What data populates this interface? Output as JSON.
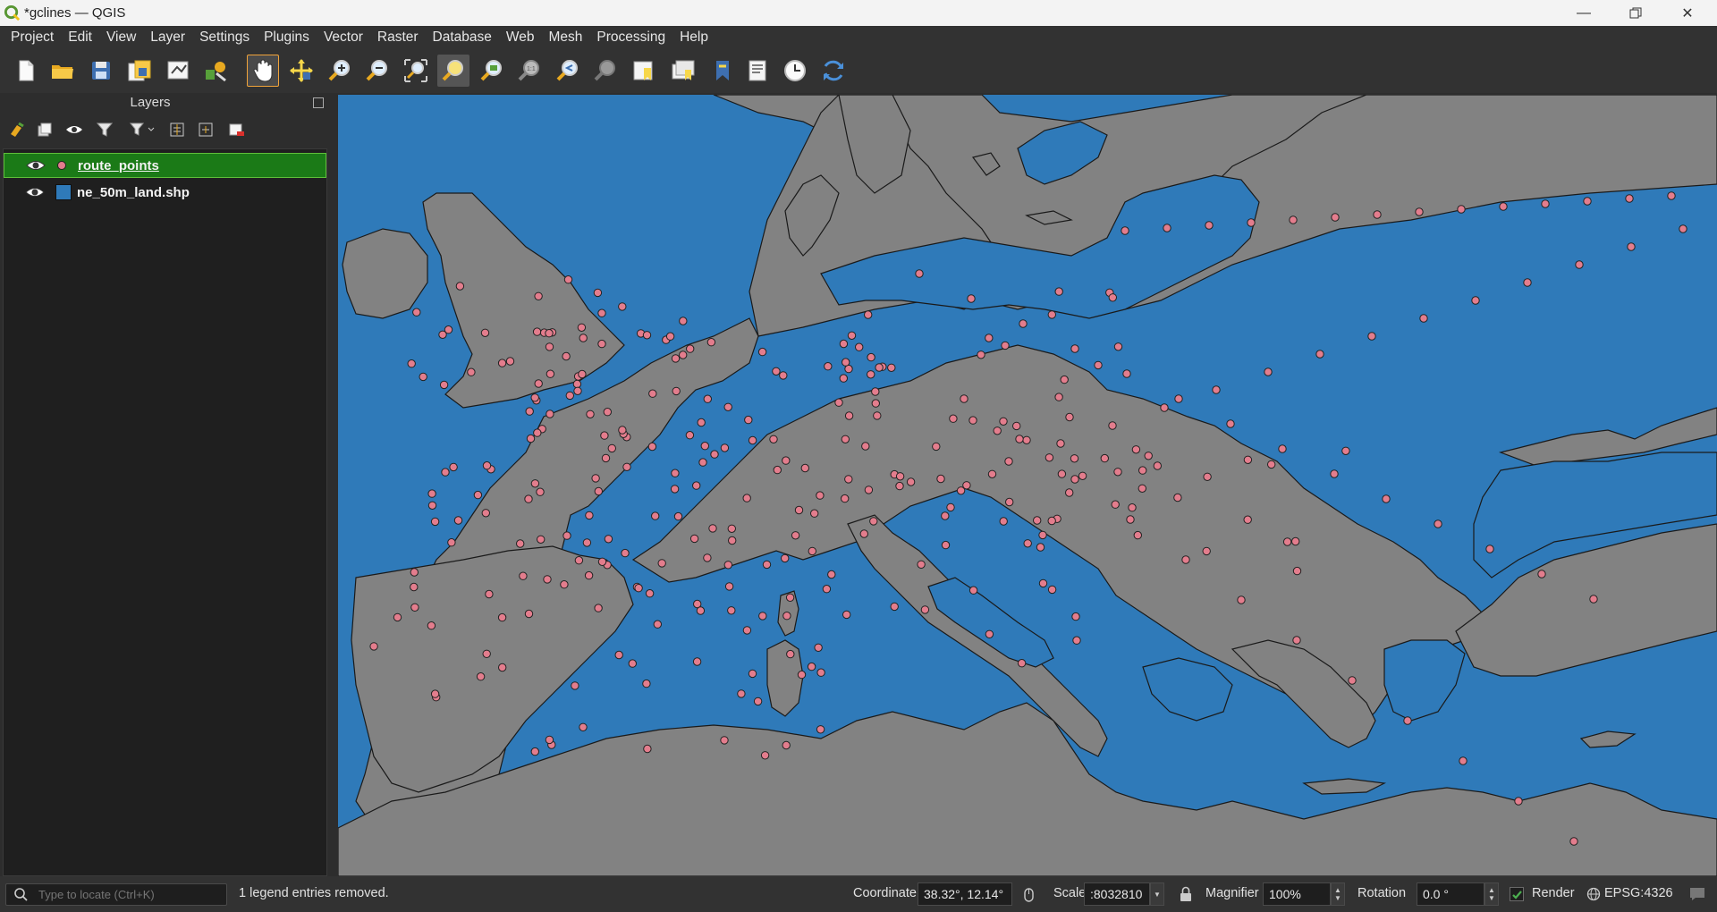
{
  "window": {
    "title": "*gclines — QGIS"
  },
  "menu": [
    "Project",
    "Edit",
    "View",
    "Layer",
    "Settings",
    "Plugins",
    "Vector",
    "Raster",
    "Database",
    "Web",
    "Mesh",
    "Processing",
    "Help"
  ],
  "toolbar_icons": [
    "new-project-icon",
    "open-project-icon",
    "save-project-icon",
    "save-as-icon",
    "print-layout-icon",
    "style-manager-icon",
    "pan-hand-icon",
    "pan-to-selection-icon",
    "zoom-in-icon",
    "zoom-out-icon",
    "zoom-full-icon",
    "zoom-to-selection-icon",
    "zoom-to-layer-icon",
    "zoom-native-icon",
    "zoom-last-icon",
    "zoom-next-icon",
    "new-bookmark-icon",
    "show-bookmarks-icon",
    "new-spatial-bookmark-icon",
    "decorations-icon",
    "temporal-controller-icon",
    "refresh-icon"
  ],
  "layers_panel": {
    "title": "Layers",
    "tool_icons": [
      "open-layer-styling-icon",
      "add-group-icon",
      "manage-visibility-icon",
      "filter-legend-icon",
      "filter-by-expression-icon",
      "expand-all-icon",
      "collapse-all-icon",
      "remove-layer-icon"
    ],
    "layers": [
      {
        "name": "route_points",
        "symbol": "point",
        "color": "#e37d8d",
        "visible": true,
        "selected": true
      },
      {
        "name": "ne_50m_land.shp",
        "symbol": "fill",
        "color": "#2f7ab9",
        "visible": true,
        "selected": false
      }
    ]
  },
  "map": {
    "water_color": "#2f7ab9",
    "land_color": "#828282",
    "point_color": "#e37d8d"
  },
  "status": {
    "locator_placeholder": "Type to locate (Ctrl+K)",
    "message": "1 legend entries removed.",
    "coordinate_label": "Coordinate",
    "coordinate_value": "38.32°, 12.14°",
    "scale_label": "Scale",
    "scale_value": ":8032810",
    "magnifier_label": "Magnifier",
    "magnifier_value": "100%",
    "rotation_label": "Rotation",
    "rotation_value": "0.0 °",
    "render_label": "Render",
    "render_checked": true,
    "crs": "EPSG:4326"
  }
}
